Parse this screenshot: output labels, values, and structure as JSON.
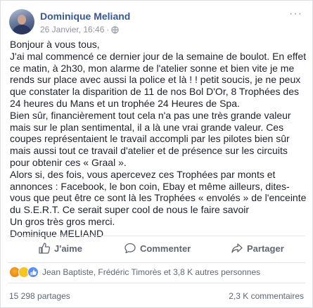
{
  "post": {
    "author": "Dominique Meliand",
    "timestamp": "26 Janvier, 16:46",
    "separator": "·",
    "privacy_icon": "globe-icon",
    "paragraphs": [
      "Bonjour à vous tous,",
      "J'ai mal commencé ce dernier jour de la semaine de boulot. En effet ce matin, à 2h30, mon alarme de l'atelier sonne et bien vite je me rends sur place avec aussi la police et là ! ! petit soucis, je ne peux que constater la disparition de 11 de nos Bol D'Or, 8 Trophées des 24 heures du Mans et un trophée 24 Heures de Spa.",
      "Bien sûr, financièrement tout cela n'a pas une très grande valeur mais sur le plan sentimental, il a là une vrai grande valeur. Ces coupes représentaient le travail accompli par les pilotes bien sûr mais aussi tout ce travail d'atelier et de présence sur les circuits pour obtenir ces « Graal ».",
      "Alors si, des fois, vous apercevez ces Trophées par monts et annonces : Facebook, le bon coin, Ebay et même ailleurs, dites-vous que peut être ce sont là les Trophées « envolés » de l'enceinte du S.E.R.T. Ce serait super cool de nous le faire savoir",
      "Un gros très gros merci.",
      "Dominique MELIAND"
    ]
  },
  "actions": {
    "like_label": "J'aime",
    "comment_label": "Commenter",
    "share_label": "Partager"
  },
  "reactions": {
    "icons": [
      "angry-icon",
      "sad-icon",
      "like-icon"
    ],
    "summary": "Jean Baptiste, Frédéric Timorès et 3,8 K autres personnes"
  },
  "stats": {
    "shares": "15 298 partages",
    "comments": "2,3 K commentaires"
  },
  "colors": {
    "author": "#365899",
    "meta": "#90949c",
    "action": "#606770",
    "like_blue": "#5890ff"
  }
}
